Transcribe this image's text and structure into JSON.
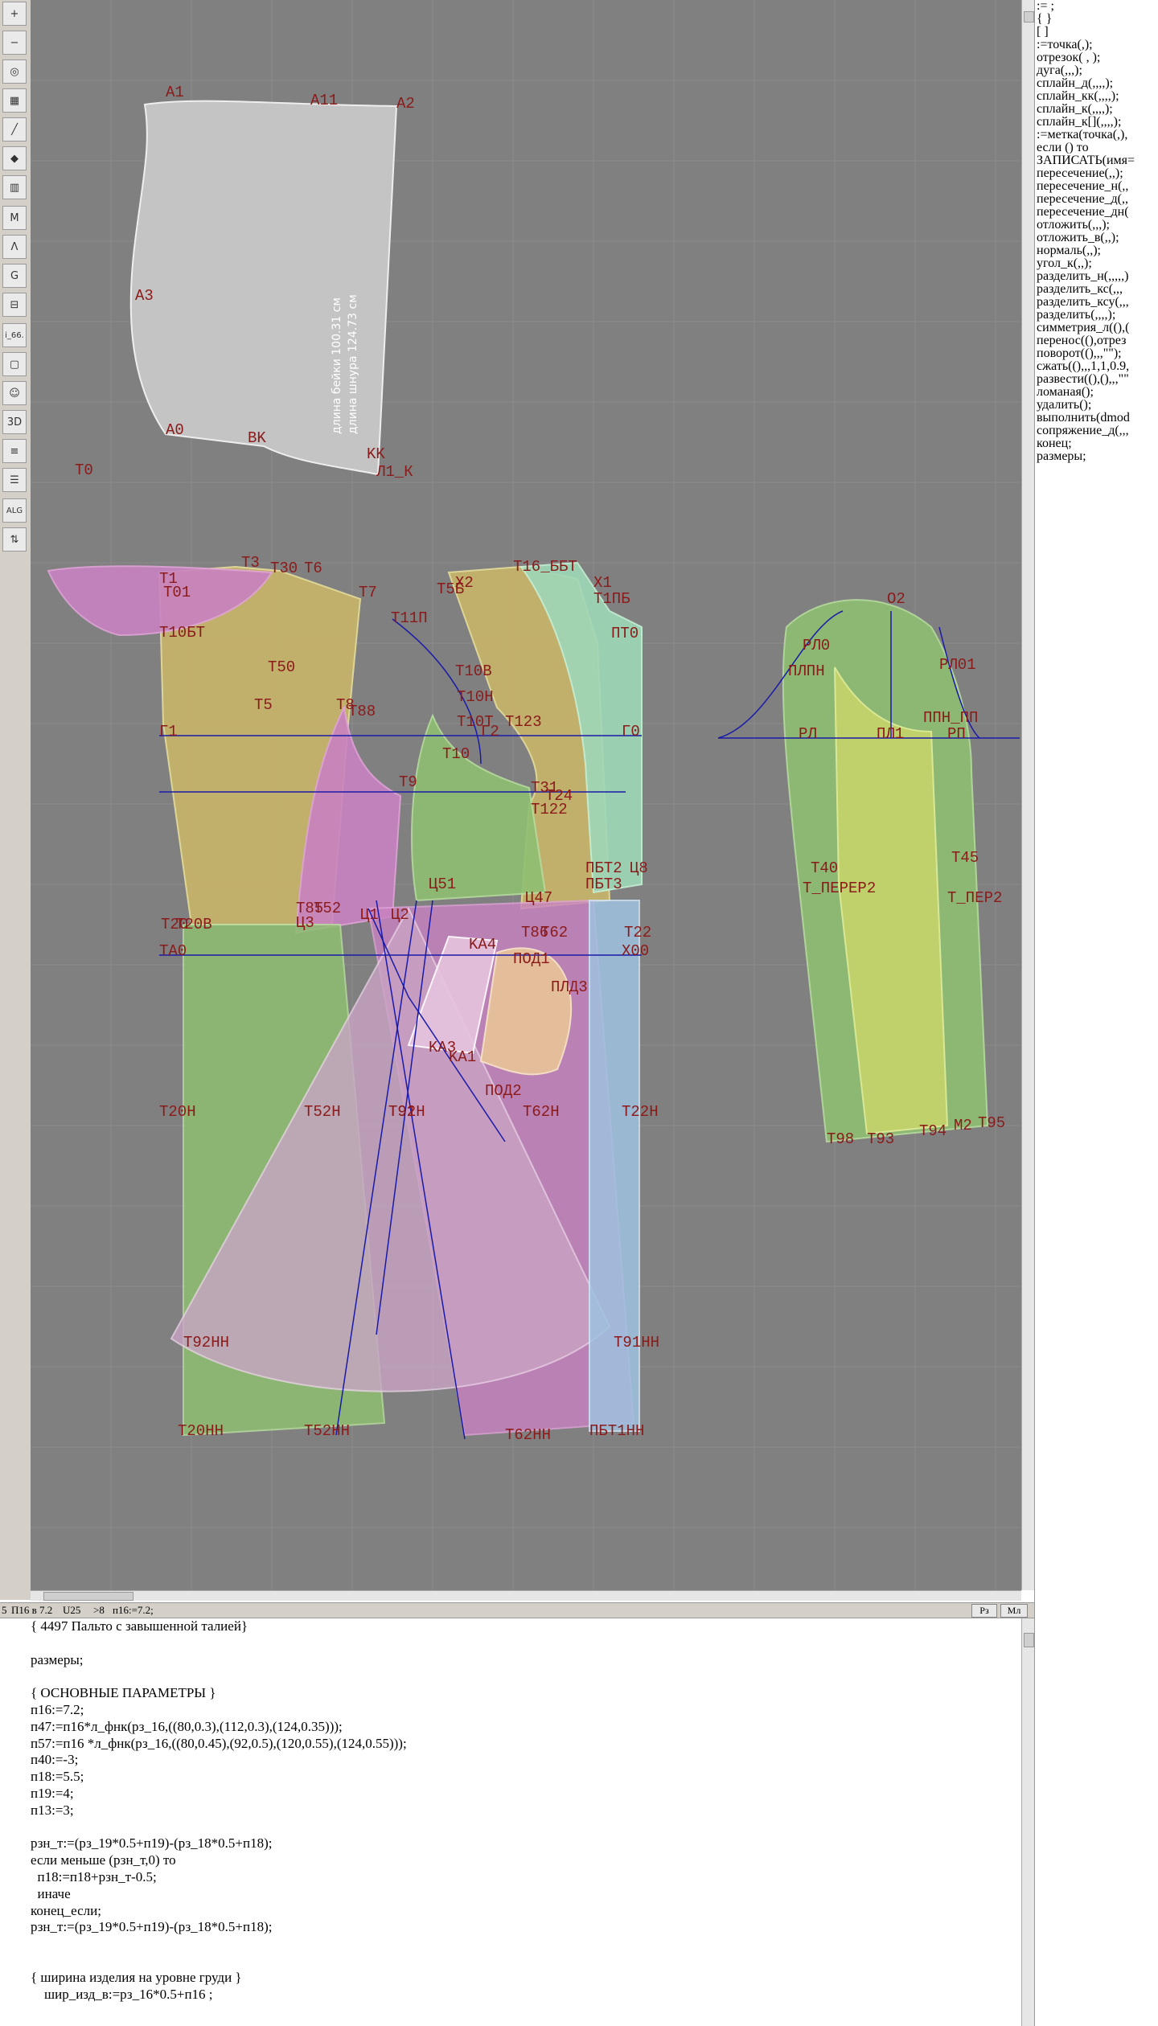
{
  "toolbar": {
    "tools": [
      {
        "icon": "zoom-in-icon",
        "glyph": "+"
      },
      {
        "icon": "zoom-out-icon",
        "glyph": "−"
      },
      {
        "icon": "zoom-fit-icon",
        "glyph": "◎"
      },
      {
        "icon": "grid-icon",
        "glyph": "▦"
      },
      {
        "icon": "line-tool-icon",
        "glyph": "╱"
      },
      {
        "icon": "paint-icon",
        "glyph": "◆"
      },
      {
        "icon": "pattern-icon",
        "glyph": "▥"
      },
      {
        "icon": "measure-m-icon",
        "glyph": "M"
      },
      {
        "icon": "compass-icon",
        "glyph": "Λ"
      },
      {
        "icon": "g-tool-icon",
        "glyph": "G"
      },
      {
        "icon": "ruler-icon",
        "glyph": "⊟"
      },
      {
        "icon": "counter-icon",
        "glyph": "i_66."
      },
      {
        "icon": "page-icon",
        "glyph": "▢"
      },
      {
        "icon": "avatar-icon",
        "glyph": "☺"
      },
      {
        "icon": "view-3d-icon",
        "glyph": "3D"
      },
      {
        "icon": "stack-icon",
        "glyph": "≡"
      },
      {
        "icon": "layers-icon",
        "glyph": "☰"
      },
      {
        "icon": "alg-icon",
        "glyph": "ALG"
      },
      {
        "icon": "tree-icon",
        "glyph": "⇅"
      }
    ]
  },
  "canvas": {
    "labels": [
      "A1",
      "A11",
      "A2",
      "A3",
      "A0",
      "BK",
      "KK",
      "Л1_К",
      "T0",
      "T1",
      "T01",
      "T3",
      "T30",
      "T6",
      "T7",
      "T10БТ",
      "T50",
      "T5",
      "T8",
      "T88",
      "T11П",
      "X2",
      "T5Б",
      "T16_ББТ",
      "X1",
      "Т1ПБ",
      "ПТ0",
      "T10В",
      "T10Т",
      "T123",
      "Г1",
      "Г2",
      "T10Н",
      "T10",
      "Г0",
      "T9",
      "T31",
      "T24",
      "T122",
      "ПБТ2",
      "Ц8",
      "ПБТ3",
      "Ц51",
      "T20",
      "T20В",
      "T85",
      "T52",
      "Ц3",
      "Ц1",
      "Ц2",
      "Ц47",
      "KA4",
      "T86",
      "T62",
      "ПОД1",
      "T22",
      "X00",
      "TA0",
      "ПЛД3",
      "KA3",
      "KA1",
      "ПОД2",
      "T20Н",
      "T52Н",
      "T91Н",
      "T92",
      "T62Н",
      "T22Н",
      "T92НН",
      "T91НН",
      "T20НН",
      "T52НН",
      "T62НН",
      "ПБТ1НН",
      "O2",
      "PЛ0",
      "PЛ01",
      "ПЛПН",
      "PЛ",
      "ПЛ1",
      "РП",
      "ППН_ПП",
      "T40",
      "T45",
      "T_ПЕРЕР2",
      "T_ПЕР2",
      "T98",
      "T93",
      "T94",
      "M2",
      "T95"
    ],
    "side_text_1": "длина бейки 100.31 см",
    "side_text_2": "длина шнура 124.73 см"
  },
  "functions": [
    ":= ;",
    "{ }",
    "[ ]",
    ":=точка(,);",
    "отрезок( , );",
    "дуга(,,,);",
    "сплайн_д(,,,,);",
    "сплайн_кк(,,,,);",
    "сплайн_к(,,,,);",
    "сплайн_к[](,,,,);",
    ":=метка(точка(,),",
    "если () то",
    "ЗАПИСАТЬ(имя=",
    "пересечение(,,);",
    "пересечение_н(,,",
    "пересечение_д(,,",
    "пересечение_дн(",
    "отложить(,,,);",
    "отложить_в(,,);",
    "нормаль(,,);",
    "угол_к(,,);",
    "разделить_н(,,,,,)",
    "разделить_кс(,,,",
    "разделить_ксу(,,,",
    "разделить(,,,,);",
    "симметрия_л((),(",
    "перенос((),отрез",
    "поворот((),,,\"\");",
    "сжать((),,,1,1,0.9,",
    "развести((),(),,,\"\"",
    "ломаная();",
    "удалить();",
    "выполнить(dmod",
    "сопряжение_д(,,,",
    "конец;",
    "размеры;"
  ],
  "status": {
    "cell1": "5",
    "cell2": "П16 в 7.2",
    "cell3": "U25",
    "cell4": ">8",
    "cell5": "п16:=7.2;",
    "btn_rz": "Рз",
    "btn_ml": "Мл"
  },
  "code_lines": [
    "{ 4497 Пальто с завышенной талией}",
    "",
    "размеры;",
    "",
    "{ ОСНОВНЫЕ ПАРАМЕТРЫ }",
    "п16:=7.2;",
    "п47:=п16*л_фнк(рз_16,((80,0.3),(112,0.3),(124,0.35)));",
    "п57:=п16 *л_фнк(рз_16,((80,0.45),(92,0.5),(120,0.55),(124,0.55)));",
    "п40:=-3;",
    "п18:=5.5;",
    "п19:=4;",
    "п13:=3;",
    "",
    "рзн_т:=(рз_19*0.5+п19)-(рз_18*0.5+п18);",
    "если меньше (рзн_т,0) то",
    "  п18:=п18+рзн_т-0.5;",
    "  иначе",
    "конец_если;",
    "рзн_т:=(рз_19*0.5+п19)-(рз_18*0.5+п18);",
    "",
    "",
    "{ ширина изделия на уровне груди }",
    "    шир_изд_в:=рз_16*0.5+п16 ;"
  ]
}
